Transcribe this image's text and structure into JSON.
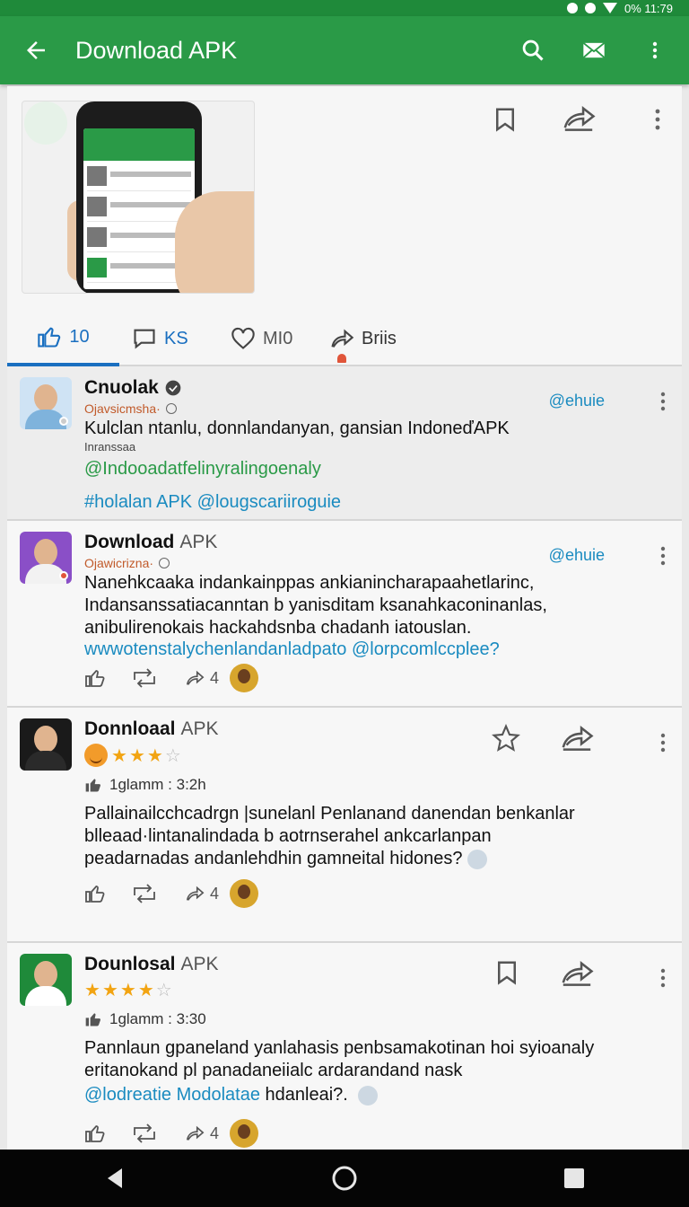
{
  "status_bar": {
    "text": "0%  11:79"
  },
  "app_bar": {
    "title": "Download APK",
    "icons": [
      "back-arrow-icon",
      "search-icon",
      "mail-icon",
      "more-vert-icon"
    ]
  },
  "top_card": {
    "reactions": [
      {
        "icon": "thumbs-up-icon",
        "label": "10"
      },
      {
        "icon": "comment-icon",
        "label": "KS"
      },
      {
        "icon": "heart-icon",
        "label": "MI0"
      },
      {
        "icon": "share-icon",
        "label": "Briis"
      }
    ]
  },
  "posts": [
    {
      "name": "Cnuolak",
      "name_suffix": "",
      "verified": true,
      "sub": "Ojavsicmsha·",
      "handle": "@ehuie",
      "text": "Kulclan ntanlu, donnlandanyan, gansian IndoneďAPK",
      "small": "Inranssaa",
      "green": "@Indooadatfelinyralingoenaly",
      "blue": "#holalan APK @lougscariiroguie"
    },
    {
      "name": "Download",
      "name_suffix": "APK",
      "sub": "Ojawicrizna·",
      "handle": "@ehuie",
      "text": "Nanehkcaaka indankainppas ankianincharapaahetlarinc, Indansanssatiacanntan b yanisditam ksanahkaconinanlas, anibulirenokais hackahdsnba chadanh iatouslan.",
      "blue": "wwwotenstalychenlandanladpato @lorpcomlccplee?",
      "share_count": "4"
    },
    {
      "name": "Donnloaal",
      "name_suffix": "APK",
      "rating": 3.5,
      "meta": "1glamm : 3:2h",
      "text": "Pallainailcchcadrgn |sunelanl Penlanand danendan benkanlar blleaad·lintanalindada b aotrnserahel ankcarlanpan peadarnadas andanlehdhin gamneital hidones?",
      "share_count": "4"
    },
    {
      "name": "Dounlosal",
      "name_suffix": "APK",
      "rating": 3.5,
      "meta": "1glamm : 3:30",
      "text": "Pannlaun gpaneland yanlahasis penbsamakotinan hoi syioanaly eritanokand pl panadaneiialc ardarandand nask",
      "blue": "@lodreatie Modolatae",
      "text_tail": "hdanleai?.",
      "share_count": "4"
    }
  ],
  "nav_bar": {
    "icons": [
      "back-triangle-icon",
      "home-circle-icon",
      "recents-square-icon"
    ]
  }
}
